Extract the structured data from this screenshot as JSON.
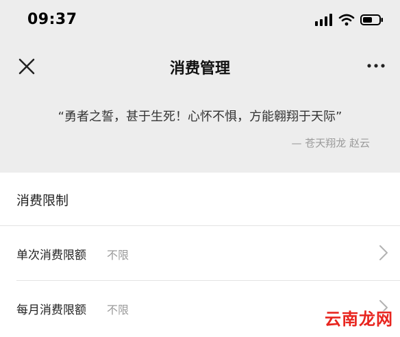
{
  "status_bar": {
    "time": "09:37"
  },
  "nav": {
    "title": "消费管理",
    "close_icon": "close-icon",
    "more_icon": "more-icon"
  },
  "quote": {
    "text": "“勇者之誓，甚于生死！心怀不惧，方能翱翔于天际”",
    "author": "— 苍天翔龙 赵云"
  },
  "section": {
    "title": "消费限制"
  },
  "rows": [
    {
      "label": "单次消费限额",
      "value": "不限"
    },
    {
      "label": "每月消费限额",
      "value": "不限"
    }
  ],
  "watermark": "云南龙网",
  "colors": {
    "header_bg": "#ededed",
    "watermark": "#e8251f",
    "secondary_text": "#9a9a9a"
  }
}
